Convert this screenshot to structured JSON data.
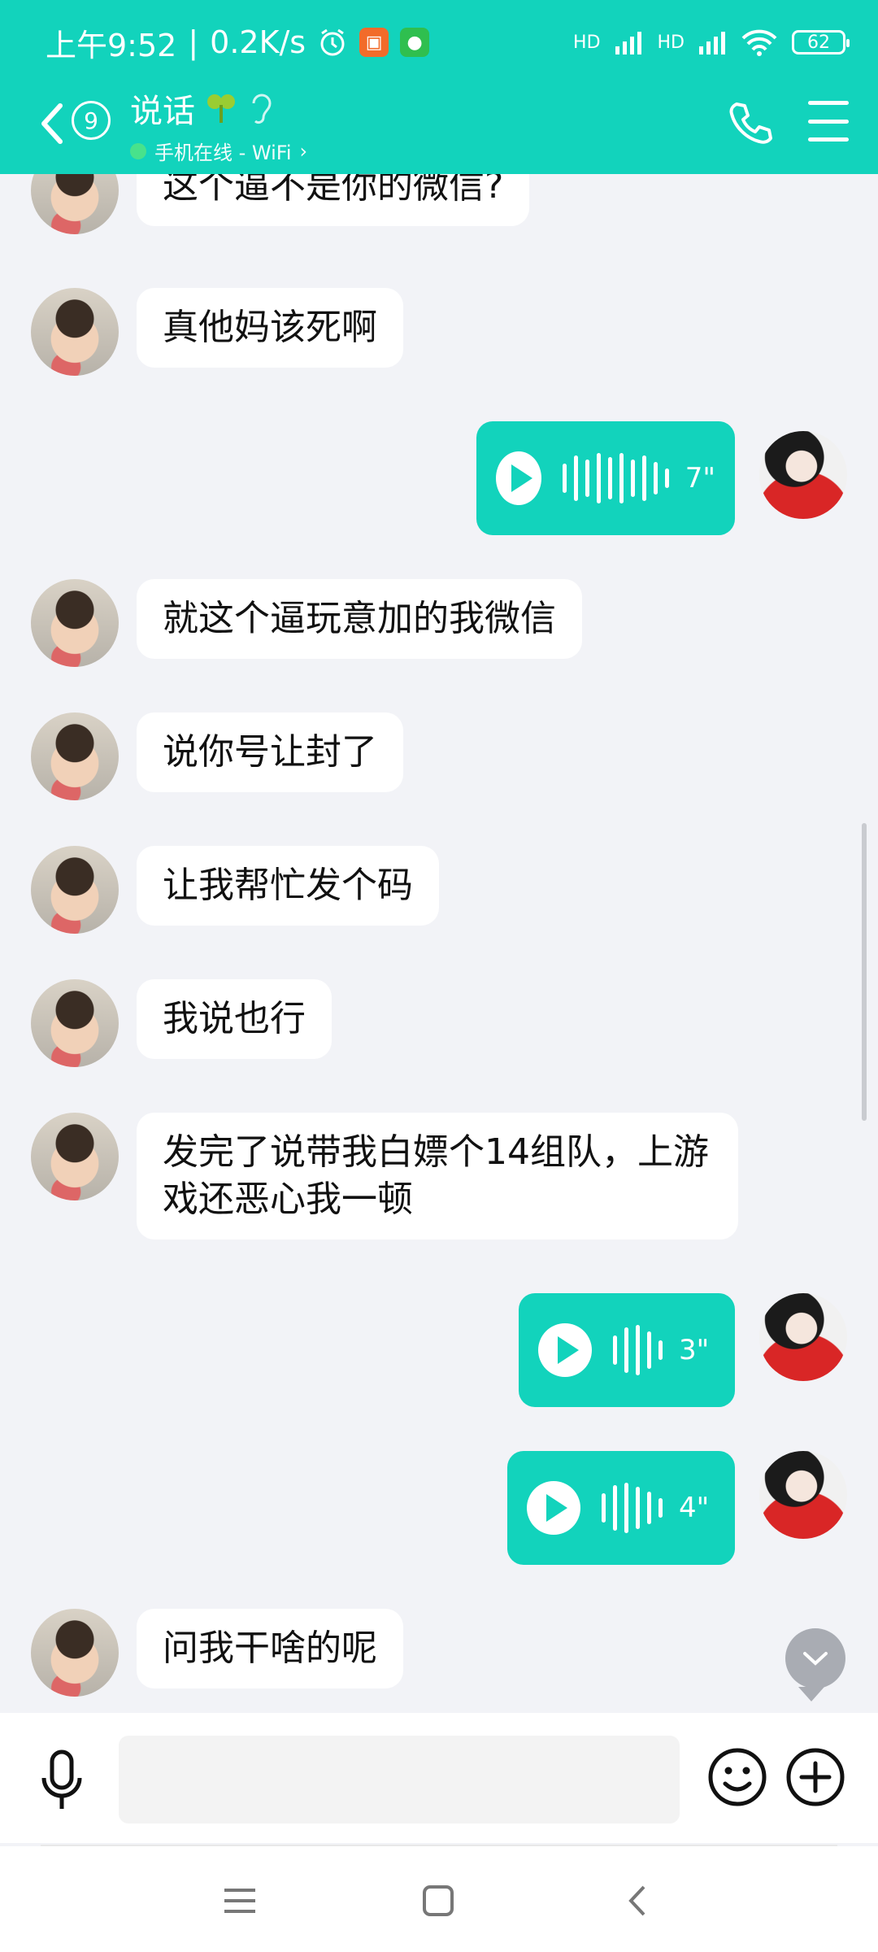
{
  "status_bar": {
    "time": "上午9:52",
    "net_speed": "0.2K/s",
    "battery": "62",
    "signal_labels": [
      "HD",
      "HD"
    ]
  },
  "header": {
    "unread_count": "9",
    "contact_name": "说话",
    "online_status": "手机在线 - WiFi"
  },
  "messages": [
    {
      "side": "left",
      "type": "text",
      "text": "这个逼不是你的微信?"
    },
    {
      "side": "left",
      "type": "text",
      "text": "真他妈该死啊"
    },
    {
      "side": "right",
      "type": "voice",
      "duration": "7\""
    },
    {
      "side": "left",
      "type": "text",
      "text": "就这个逼玩意加的我微信"
    },
    {
      "side": "left",
      "type": "text",
      "text": "说你号让封了"
    },
    {
      "side": "left",
      "type": "text",
      "text": "让我帮忙发个码"
    },
    {
      "side": "left",
      "type": "text",
      "text": "我说也行"
    },
    {
      "side": "left",
      "type": "text",
      "text": "发完了说带我白嫖个14组队，上游戏还恶心我一顿"
    },
    {
      "side": "right",
      "type": "voice",
      "duration": "3\""
    },
    {
      "side": "right",
      "type": "voice",
      "duration": "4\""
    },
    {
      "side": "left",
      "type": "text",
      "text": "问我干啥的呢"
    }
  ],
  "input": {
    "placeholder": ""
  },
  "colors": {
    "accent": "#12d3bc",
    "chat_bg": "#f2f3f7"
  },
  "icons": [
    "back-arrow-icon",
    "phone-icon",
    "menu-icon",
    "microphone-icon",
    "emoji-icon",
    "plus-icon",
    "chevron-down-icon",
    "clover-icon",
    "ear-icon",
    "alarm-icon",
    "wifi-icon"
  ]
}
